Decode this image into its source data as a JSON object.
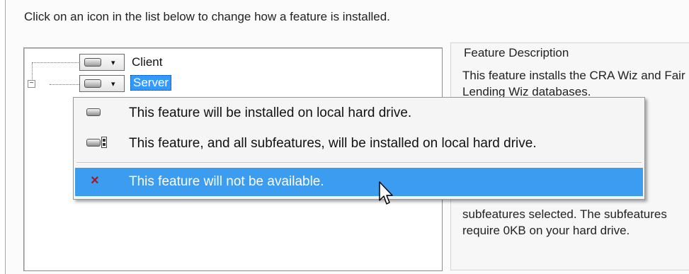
{
  "instruction": "Click on an icon in the list below to change how a feature is installed.",
  "tree": {
    "items": [
      {
        "label": "Client",
        "icon": "hard-drive-icon",
        "selected": false
      },
      {
        "label": "Server",
        "icon": "hard-drive-icon",
        "selected": true
      }
    ],
    "expander_symbol": "−",
    "dropdown_symbol": "▾"
  },
  "description": {
    "heading": "Feature Description",
    "text_top": "This feature installs the CRA Wiz and Fair Lending Wiz databases.",
    "text_bottom": "subfeatures selected. The subfeatures require 0KB on your hard drive."
  },
  "menu": {
    "items": [
      {
        "label": "This feature will be installed on local hard drive.",
        "icon": "hard-drive-icon"
      },
      {
        "label": "This feature, and all subfeatures, will be installed on local hard drive.",
        "icon": "hard-drive-subfeatures-icon"
      },
      {
        "label": "This feature will not be available.",
        "icon": "red-x-icon",
        "highlighted": true
      }
    ],
    "x_symbol": "×"
  },
  "colors": {
    "selection": "#3399ff",
    "menu_highlight": "#3c9cf0",
    "unavailable_x": "#9e1c22"
  }
}
